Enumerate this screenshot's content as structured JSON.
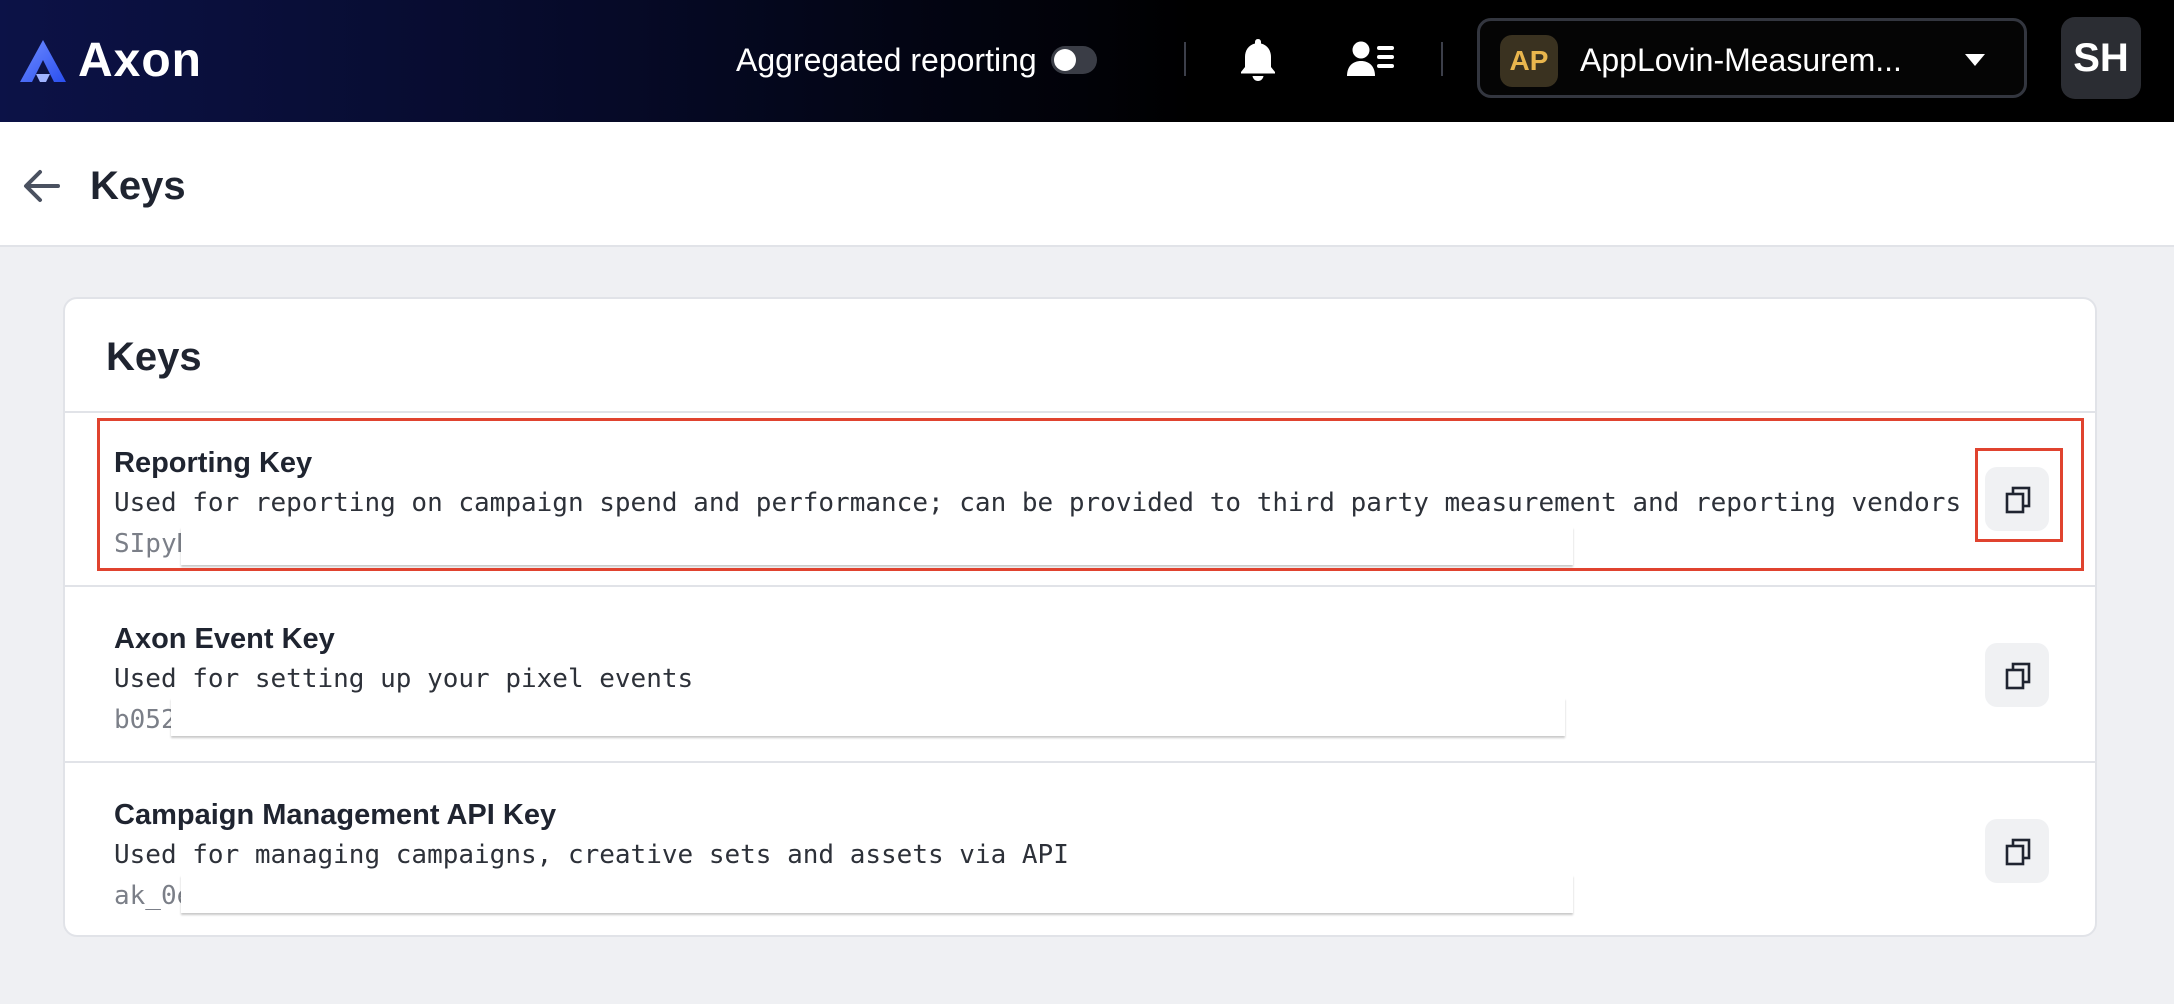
{
  "topbar": {
    "brand": "Axon",
    "aggregated_label": "Aggregated reporting",
    "aggregated_on": false,
    "account_initials": "AP",
    "account_name": "AppLovin-Measurem...",
    "profile_initials": "SH",
    "colors": {
      "account_badge_text": "#e9b64d",
      "brand_gradient": "#3a5cf4"
    }
  },
  "page": {
    "title": "Keys"
  },
  "card": {
    "title": "Keys",
    "keys": [
      {
        "name": "Reporting Key",
        "description": "Used for reporting on campaign spend and performance; can be provided to third party measurement and reporting vendors",
        "value_visible": "SIpyD"
      },
      {
        "name": "Axon Event Key",
        "description": "Used for setting up your pixel events",
        "value_visible": "b052"
      },
      {
        "name": "Campaign Management API Key",
        "description": "Used for managing campaigns, creative sets and assets via API",
        "value_visible": "ak_0e"
      }
    ]
  },
  "highlight_color": "#e0432f"
}
